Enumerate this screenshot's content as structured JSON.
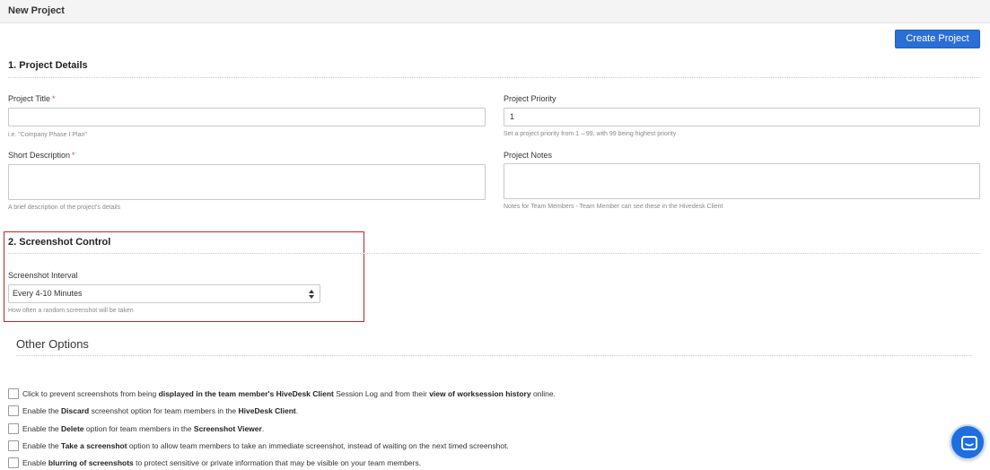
{
  "header": {
    "title": "New Project"
  },
  "actions": {
    "create_label": "Create Project"
  },
  "section1": {
    "title": "1. Project Details",
    "project_title": {
      "label": "Project Title",
      "required": "*",
      "value": "",
      "hint": "i.e. \"Company Phase I Plan\""
    },
    "short_description": {
      "label": "Short Description",
      "required": "*",
      "value": "",
      "hint": "A brief description of the project's details"
    },
    "project_priority": {
      "label": "Project Priority",
      "value": "1",
      "hint": "Set a project priority from 1 – 99, with 99 being highest priority"
    },
    "project_notes": {
      "label": "Project Notes",
      "value": "",
      "hint": "Notes for Team Members - Team Member can see these in the Hivedesk Client"
    }
  },
  "section2": {
    "title": "2. Screenshot Control",
    "interval": {
      "label": "Screenshot Interval",
      "selected": "Every 4-10 Minutes",
      "hint": "How often a random screenshot will be taken"
    }
  },
  "other": {
    "title": "Other Options",
    "options": [
      {
        "checked": false,
        "parts": [
          "Click to prevent screenshots from being ",
          "displayed in the team member's HiveDesk Client",
          " Session Log and from their ",
          "view of worksession history",
          " online."
        ]
      },
      {
        "checked": false,
        "parts": [
          "Enable the ",
          "Discard",
          " screenshot option for team members in the ",
          "HiveDesk Client",
          "."
        ]
      },
      {
        "checked": false,
        "parts": [
          "Enable the ",
          "Delete",
          " option for team members in the ",
          "Screenshot Viewer",
          "."
        ]
      },
      {
        "checked": false,
        "parts": [
          "Enable the ",
          "Take a screenshot",
          " option to allow team members to take an immediate screenshot, instead of waiting on the next timed screenshot.",
          "",
          ""
        ]
      },
      {
        "checked": false,
        "parts": [
          "Enable ",
          "blurring of screenshots",
          " to protect sensitive or private information that may be visible on your team members.",
          "",
          ""
        ]
      }
    ]
  },
  "colors": {
    "accent": "#2b6ed6",
    "highlight_border": "#b22a2a",
    "chat": "#1d6fe0",
    "required": "#d9534f"
  },
  "icons": {
    "select_arrows": "updown-arrows-icon",
    "chat": "chat-bubble-icon"
  }
}
